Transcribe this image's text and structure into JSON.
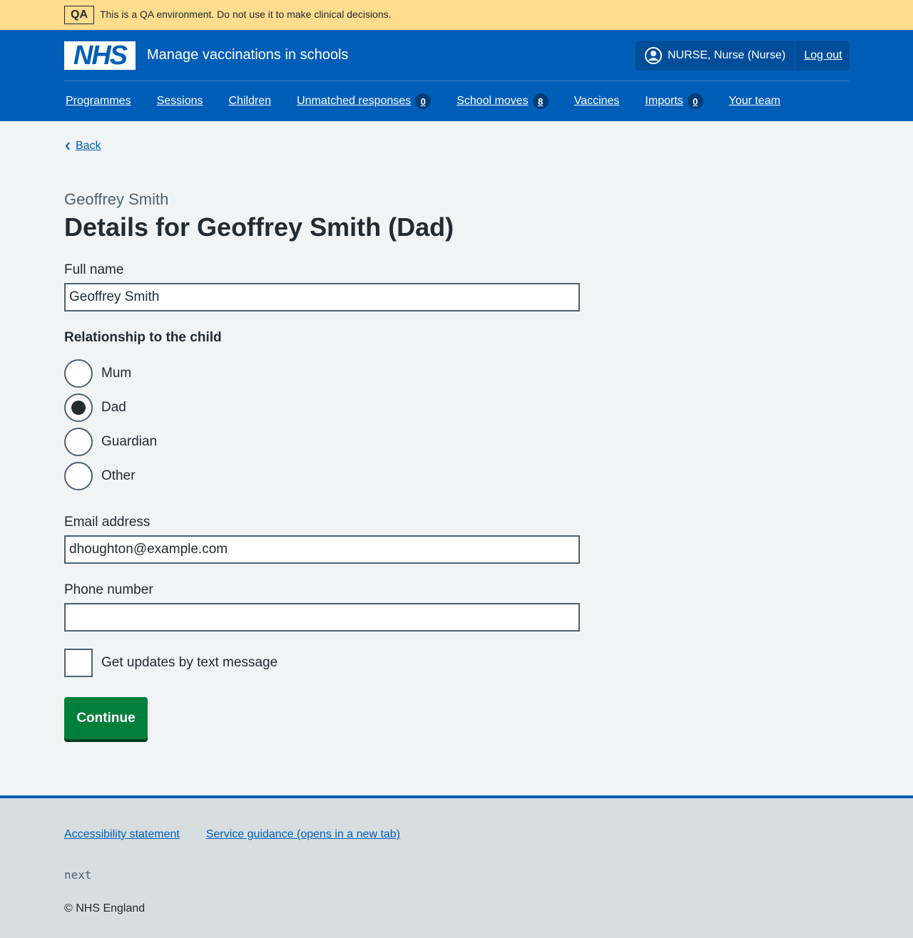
{
  "qa_banner": {
    "tag": "QA",
    "text": "This is a QA environment. Do not use it to make clinical decisions."
  },
  "header": {
    "logo": "NHS",
    "service_name": "Manage vaccinations in schools",
    "account_name": "NURSE, Nurse (Nurse)",
    "logout_label": "Log out"
  },
  "nav": {
    "programmes": "Programmes",
    "sessions": "Sessions",
    "children": "Children",
    "unmatched_responses": "Unmatched responses",
    "unmatched_count": "0",
    "school_moves": "School moves",
    "school_moves_count": "8",
    "vaccines": "Vaccines",
    "imports": "Imports",
    "imports_count": "0",
    "your_team": "Your team"
  },
  "main": {
    "back_label": "Back",
    "caption": "Geoffrey Smith",
    "title": "Details for Geoffrey Smith (Dad)",
    "full_name_label": "Full name",
    "full_name_value": "Geoffrey Smith",
    "relationship_legend": "Relationship to the child",
    "relationship_options": [
      "Mum",
      "Dad",
      "Guardian",
      "Other"
    ],
    "relationship_selected": "Dad",
    "email_label": "Email address",
    "email_value": "dhoughton@example.com",
    "phone_label": "Phone number",
    "phone_value": "",
    "text_updates_label": "Get updates by text message",
    "text_updates_checked": false,
    "continue_label": "Continue"
  },
  "footer": {
    "accessibility": "Accessibility statement",
    "guidance": "Service guidance (opens in a new tab)",
    "version": "next",
    "copyright": "© NHS England"
  },
  "colors": {
    "nhs_blue": "#005eb8",
    "qa_banner": "#ffdc8e",
    "button_green": "#007f3b",
    "page_background": "#f0f4f5"
  }
}
